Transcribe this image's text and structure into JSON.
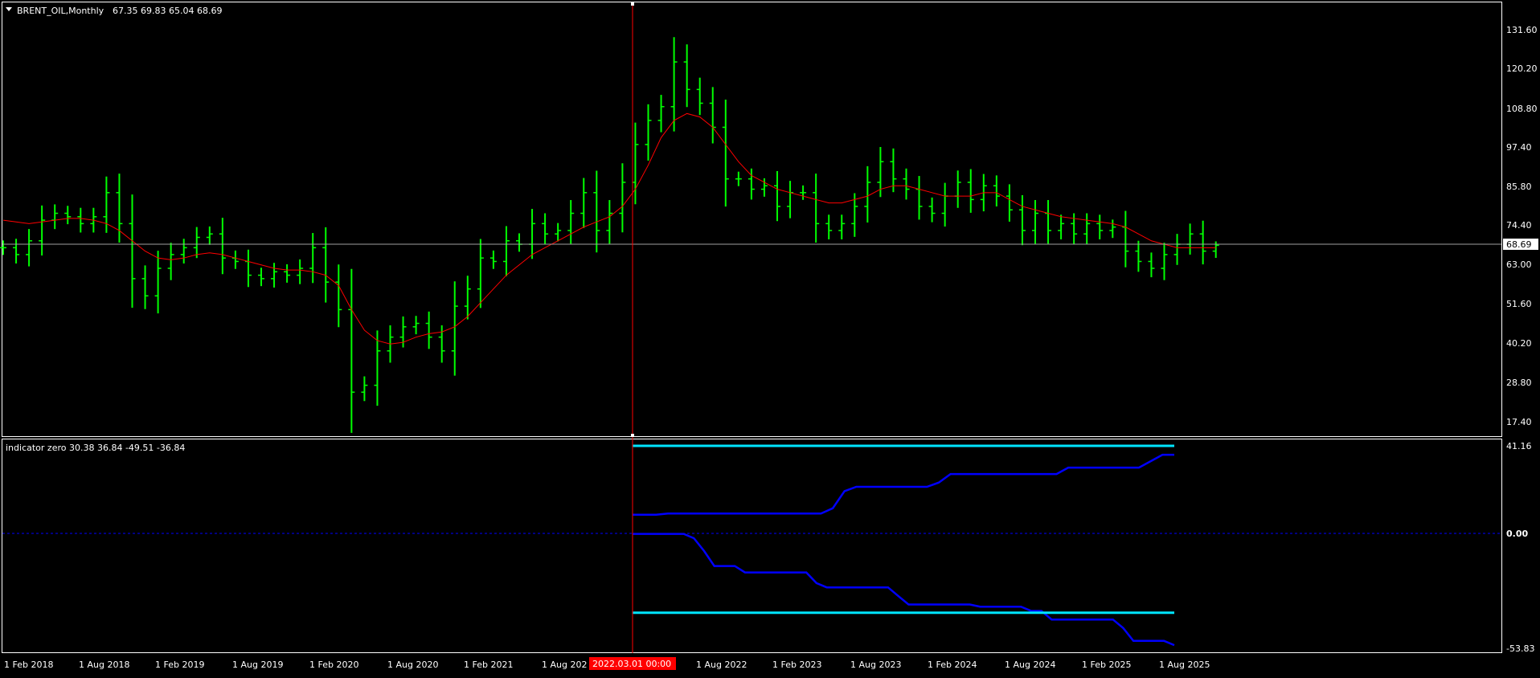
{
  "price_panel": {
    "header_symbol": "BRENT_OIL,Monthly",
    "header_ohlc": "67.35 69.83 65.04 68.69",
    "price_ticks": [
      "131.60",
      "120.20",
      "108.80",
      "97.40",
      "85.80",
      "74.40",
      "63.00",
      "51.60",
      "40.20",
      "28.80",
      "17.40"
    ],
    "current_price_label": "68.69"
  },
  "indicator_panel": {
    "header_label": "indicator zero 30.38 36.84 -49.51 -36.84",
    "value_ticks": [
      "41.16",
      "0.00",
      "-53.83"
    ]
  },
  "x_axis": {
    "ticks": [
      "1 Feb 2018",
      "1 Aug 2018",
      "1 Feb 2019",
      "1 Aug 2019",
      "1 Feb 2020",
      "1 Aug 2020",
      "1 Feb 2021",
      "1 Aug 202",
      "1 Aug 2022",
      "1 Feb 2023",
      "1 Aug 2023",
      "1 Feb 2024",
      "1 Aug 2024",
      "1 Feb 2025",
      "1 Aug 2025"
    ],
    "crosshair_label": "2022.03.01 00:00"
  },
  "colors": {
    "background": "#000000",
    "bars": "#00ff00",
    "moving_average": "#ff0000",
    "crosshair": "#ff0000",
    "indicator_bound": "#00e5ff",
    "indicator_channel": "#0000ff",
    "zero_line": "#0000ff",
    "grid_text": "#ffffff"
  },
  "chart_data": [
    {
      "type": "ohlc",
      "title": "BRENT_OIL,Monthly",
      "x_start": "2018-01",
      "x_end": "2025-08",
      "ylim": [
        17.4,
        131.6
      ],
      "last_bar": {
        "open": 67.35,
        "high": 69.83,
        "low": 65.04,
        "close": 68.69
      },
      "close_series": [
        68,
        66,
        70,
        76,
        78,
        77,
        75,
        77,
        84,
        75,
        59,
        54,
        62,
        66,
        68,
        71,
        72,
        65,
        64,
        60,
        59,
        61,
        60,
        62,
        68,
        58,
        50,
        26,
        28,
        38,
        42,
        45,
        46,
        42,
        38,
        51,
        56,
        65,
        64,
        70,
        69,
        75,
        72,
        73,
        78,
        84,
        73,
        78,
        87,
        98,
        105,
        109,
        122,
        114,
        110,
        103,
        88,
        88,
        85,
        86,
        80,
        84,
        84,
        75,
        73,
        75,
        80,
        87,
        93,
        88,
        85,
        80,
        78,
        83,
        87,
        82,
        86,
        83,
        79,
        73,
        78,
        73,
        75,
        72,
        75,
        73,
        74,
        67,
        64,
        62,
        66,
        69,
        72,
        67,
        68.69
      ],
      "moving_average": [
        76,
        75.5,
        75,
        75.5,
        76,
        76.5,
        76.5,
        76,
        75,
        73,
        70,
        67,
        65,
        64.5,
        65,
        66,
        66.5,
        66,
        65,
        64,
        63,
        62,
        61.5,
        61.5,
        61,
        60,
        57,
        50,
        44,
        41,
        40,
        40.5,
        42,
        43,
        43.5,
        45,
        48,
        52,
        56,
        60,
        63,
        66,
        68,
        70,
        72,
        74,
        75.5,
        77,
        80,
        85,
        92,
        100,
        105,
        107,
        106,
        103,
        98,
        93,
        89,
        87,
        85,
        84,
        83,
        82,
        81,
        81,
        82,
        83,
        85,
        86,
        86,
        85,
        84,
        83,
        83,
        83,
        84,
        84,
        82,
        80,
        79,
        78,
        77,
        76.5,
        76,
        75.5,
        75,
        74,
        72,
        70,
        69,
        68,
        68,
        68,
        68
      ]
    },
    {
      "type": "line",
      "title": "indicator zero",
      "x_start": "2022-03",
      "x_end": "2025-08",
      "ylim": [
        -53.83,
        41.16
      ],
      "series": [
        {
          "values": [
            41.16,
            41.16,
            41.16,
            41.16,
            41.16,
            41.16,
            41.16,
            41.16,
            41.16,
            41.16,
            41.16,
            41.16,
            41.16,
            41.16,
            41.16,
            41.16,
            41.16,
            41.16,
            41.16,
            41.16,
            41.16,
            41.16,
            41.16,
            41.16,
            41.16,
            41.16,
            41.16,
            41.16,
            41.16,
            41.16,
            41.16,
            41.16,
            41.16,
            41.16,
            41.16,
            41.16,
            41.16,
            41.16,
            41.16,
            41.16,
            41.16,
            41.16
          ]
        },
        {
          "values": [
            9,
            9,
            9,
            9.5,
            9.5,
            9.5,
            9.5,
            9.5,
            9.5,
            9.5,
            9.5,
            9.5,
            9.5,
            9.5,
            9.5,
            9.5,
            9.5,
            12,
            20,
            22,
            22,
            22,
            22,
            22,
            22,
            22,
            24,
            28,
            28,
            28,
            28,
            28,
            28,
            28,
            28,
            28,
            28,
            31,
            31,
            31,
            31,
            31,
            31,
            31,
            34,
            37,
            37
          ]
        },
        {
          "values": [
            0,
            0,
            0,
            0,
            0,
            0,
            -2,
            -8,
            -15,
            -15,
            -15,
            -18,
            -18,
            -18,
            -18,
            -18,
            -18,
            -18,
            -23,
            -25,
            -25,
            -25,
            -25,
            -25,
            -25,
            -25,
            -29,
            -33,
            -33,
            -33,
            -33,
            -33,
            -33,
            -33,
            -34,
            -34,
            -34,
            -34,
            -34,
            -36,
            -36,
            -40,
            -40,
            -40,
            -40,
            -40,
            -40,
            -40,
            -44,
            -50,
            -50,
            -50,
            -50,
            -52
          ]
        },
        {
          "values": [
            -36.84,
            -36.84,
            -36.84,
            -36.84,
            -36.84,
            -36.84,
            -36.84,
            -36.84,
            -36.84,
            -36.84,
            -36.84,
            -36.84,
            -36.84,
            -36.84,
            -36.84,
            -36.84,
            -36.84,
            -36.84,
            -36.84,
            -36.84,
            -36.84,
            -36.84,
            -36.84,
            -36.84,
            -36.84,
            -36.84,
            -36.84,
            -36.84,
            -36.84,
            -36.84,
            -36.84,
            -36.84,
            -36.84,
            -36.84,
            -36.84,
            -36.84,
            -36.84,
            -36.84,
            -36.84,
            -36.84,
            -36.84,
            -36.84
          ]
        }
      ]
    }
  ]
}
